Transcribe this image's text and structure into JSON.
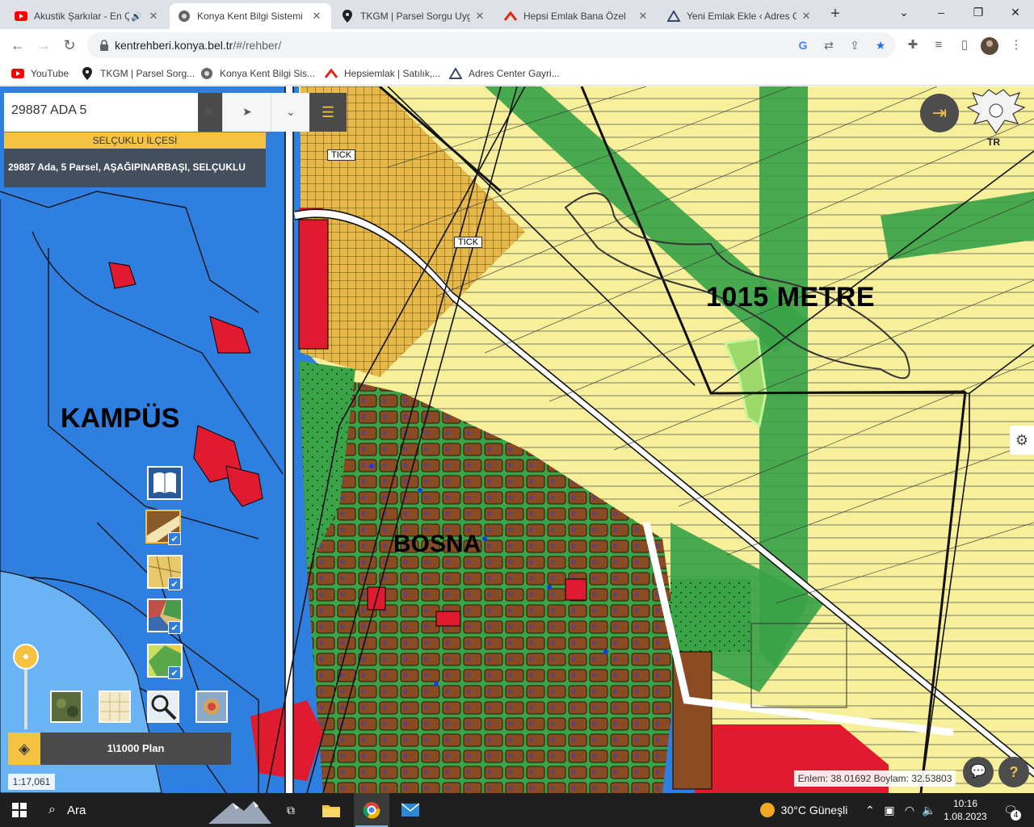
{
  "browser": {
    "tabs": [
      {
        "title": "Akustik Şarkılar - En Ç",
        "icon": "youtube-icon",
        "active": false
      },
      {
        "title": "Konya Kent Bilgi Sistemi",
        "icon": "kent-icon",
        "active": true
      },
      {
        "title": "TKGM | Parsel Sorgu Uygu",
        "icon": "pin-icon",
        "active": false
      },
      {
        "title": "Hepsi Emlak Bana Özel",
        "icon": "hepsiemlak-icon",
        "active": false
      },
      {
        "title": "Yeni Emlak Ekle ‹ Adres Ce",
        "icon": "adrescenter-icon",
        "active": false
      }
    ],
    "new_tab": "+",
    "window_controls": {
      "minimize": "⌄",
      "restore": "–",
      "maximize": "❐",
      "close": "✕"
    },
    "url_host": "kentrehberi.konya.bel.tr",
    "url_path": "/#/rehber/",
    "bookmarks": [
      {
        "label": "YouTube",
        "icon": "youtube-icon"
      },
      {
        "label": "TKGM | Parsel Sorg...",
        "icon": "pin-icon"
      },
      {
        "label": "Konya Kent Bilgi Sis...",
        "icon": "kent-icon"
      },
      {
        "label": "Hepsiemlak | Satılık,...",
        "icon": "hepsiemlak-icon"
      },
      {
        "label": "Adres Center Gayri...",
        "icon": "adrescenter-icon"
      }
    ]
  },
  "map": {
    "search": {
      "value": "29887 ADA 5",
      "clear": "✕"
    },
    "district": "SELÇUKLU İLÇESİ",
    "result": "29887 Ada, 5 Parsel, AŞAĞIPINARBAŞI, SELÇUKLU",
    "labels": {
      "kampus": "KAMPÜS",
      "bosna": "BOSNA",
      "distance": "1015 METRE",
      "tick1": "TICK",
      "tick2": "TICK"
    },
    "emblem_text": "TR",
    "plan_label": "1\\1000 Plan",
    "scale": "1:17,061",
    "coords": "Enlem: 38.01692 Boylam: 32.53803",
    "help": "?"
  },
  "taskbar": {
    "search_placeholder": "Ara",
    "weather": "30°C  Güneşli",
    "time": "10:16",
    "date": "1.08.2023",
    "notifications": "4"
  },
  "colors": {
    "accent": "#f5c242",
    "map_blue": "#2f7fe0",
    "zone_yellow": "#f7ef9a",
    "zone_green": "#3aa348",
    "zone_brown": "#8a4a22",
    "zone_red": "#e01b2f"
  }
}
